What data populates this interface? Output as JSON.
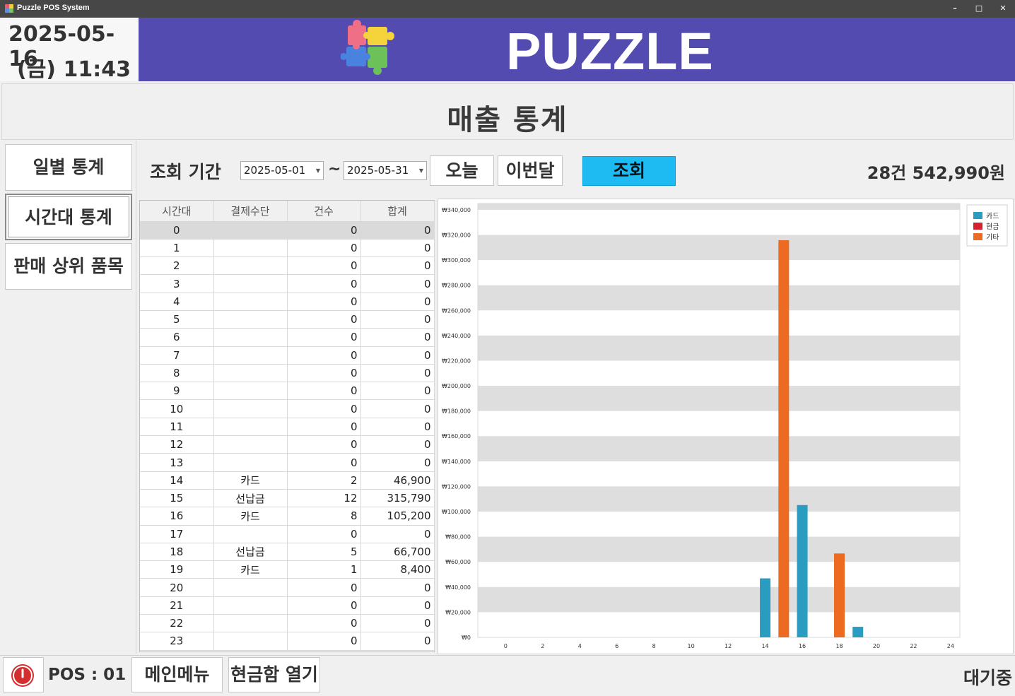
{
  "window": {
    "title": "Puzzle POS System",
    "minimize": "–",
    "maximize": "□",
    "close": "✕"
  },
  "clock": {
    "date": "2025-05-16",
    "time": "(금) 11:43"
  },
  "brand": {
    "logo": "PUZZLE"
  },
  "page": {
    "title": "매출 통계"
  },
  "nav": [
    {
      "label": "일별 통계"
    },
    {
      "label": "시간대 통계"
    },
    {
      "label": "판매 상위 품목"
    }
  ],
  "filter": {
    "label": "조회 기간",
    "start": "2025-05-01",
    "end": "2025-05-31",
    "tilde": "~",
    "today_btn": "오늘",
    "month_btn": "이번달",
    "query_btn": "조회",
    "summary": "28건 542,990원"
  },
  "table": {
    "columns": [
      "시간대",
      "결제수단",
      "건수",
      "합계"
    ],
    "rows": [
      [
        "0",
        "",
        "0",
        "0"
      ],
      [
        "1",
        "",
        "0",
        "0"
      ],
      [
        "2",
        "",
        "0",
        "0"
      ],
      [
        "3",
        "",
        "0",
        "0"
      ],
      [
        "4",
        "",
        "0",
        "0"
      ],
      [
        "5",
        "",
        "0",
        "0"
      ],
      [
        "6",
        "",
        "0",
        "0"
      ],
      [
        "7",
        "",
        "0",
        "0"
      ],
      [
        "8",
        "",
        "0",
        "0"
      ],
      [
        "9",
        "",
        "0",
        "0"
      ],
      [
        "10",
        "",
        "0",
        "0"
      ],
      [
        "11",
        "",
        "0",
        "0"
      ],
      [
        "12",
        "",
        "0",
        "0"
      ],
      [
        "13",
        "",
        "0",
        "0"
      ],
      [
        "14",
        "카드",
        "2",
        "46,900"
      ],
      [
        "15",
        "선납금",
        "12",
        "315,790"
      ],
      [
        "16",
        "카드",
        "8",
        "105,200"
      ],
      [
        "17",
        "",
        "0",
        "0"
      ],
      [
        "18",
        "선납금",
        "5",
        "66,700"
      ],
      [
        "19",
        "카드",
        "1",
        "8,400"
      ],
      [
        "20",
        "",
        "0",
        "0"
      ],
      [
        "21",
        "",
        "0",
        "0"
      ],
      [
        "22",
        "",
        "0",
        "0"
      ],
      [
        "23",
        "",
        "0",
        "0"
      ]
    ]
  },
  "chart_data": {
    "type": "bar",
    "x_ticks": [
      "0",
      "2",
      "4",
      "6",
      "8",
      "10",
      "12",
      "14",
      "16",
      "18",
      "20",
      "22",
      "24"
    ],
    "y_ticks": [
      "₩0",
      "₩20,000",
      "₩40,000",
      "₩60,000",
      "₩80,000",
      "₩100,000",
      "₩120,000",
      "₩140,000",
      "₩160,000",
      "₩180,000",
      "₩200,000",
      "₩220,000",
      "₩240,000",
      "₩260,000",
      "₩280,000",
      "₩300,000",
      "₩320,000",
      "₩340,000"
    ],
    "xlim": [
      -1.5,
      24.5
    ],
    "ylim": [
      0,
      345000
    ],
    "grid": "alternating horizontal bands",
    "legend_position": "top-right",
    "series": [
      {
        "name": "카드",
        "color": "#2a9cc0",
        "points": [
          [
            14,
            46900
          ],
          [
            16,
            105200
          ],
          [
            19,
            8400
          ]
        ]
      },
      {
        "name": "현금",
        "color": "#d6212f",
        "points": []
      },
      {
        "name": "기타",
        "color": "#ed6a22",
        "points": [
          [
            15,
            315790
          ],
          [
            18,
            66700
          ]
        ]
      }
    ]
  },
  "bottom": {
    "pos": "POS : 01",
    "main_menu": "메인메뉴",
    "open_drawer": "현금함 열기",
    "status": "대기중"
  }
}
